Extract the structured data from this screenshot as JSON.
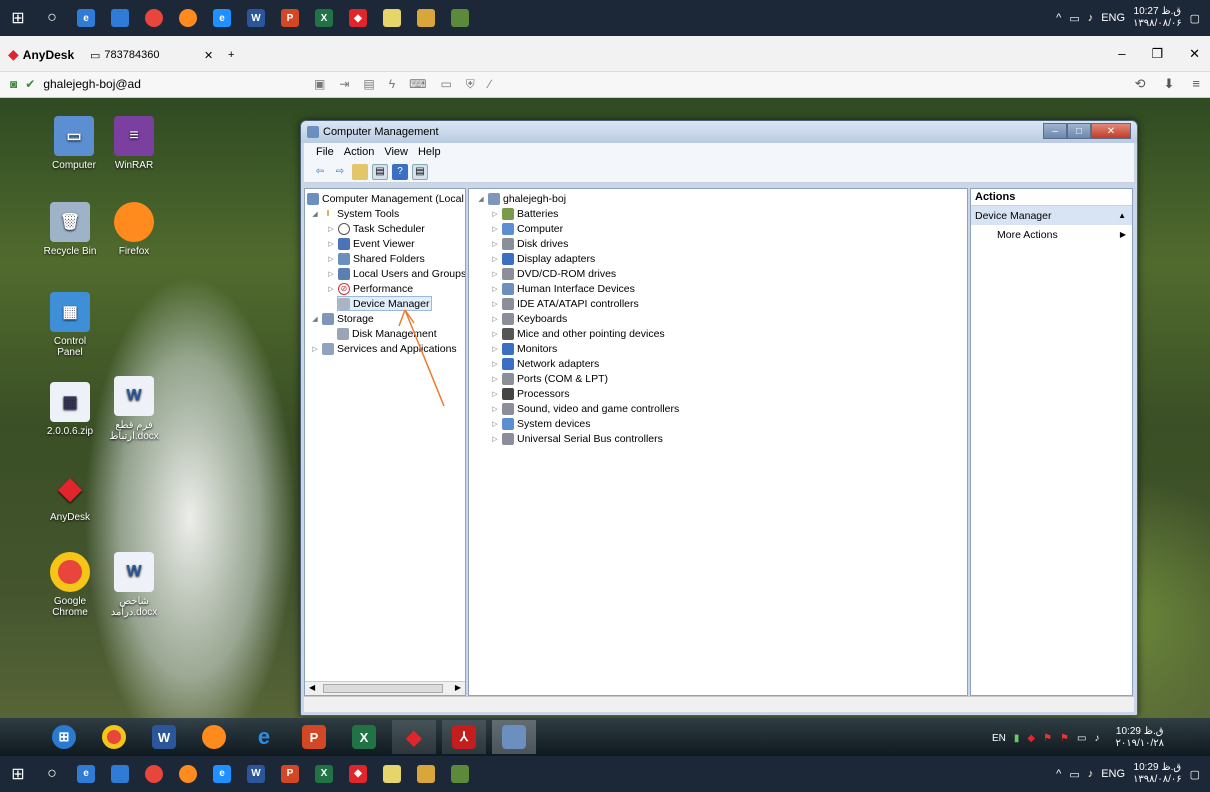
{
  "host_taskbar": {
    "tray": {
      "lang": "ENG",
      "time_top": "10:27 ق.ظ",
      "date_top": "۱۳۹۸/۰۸/۰۶",
      "time_bottom": "10:29 ق.ظ",
      "date_bottom": "۱۳۹۸/۰۸/۰۶"
    }
  },
  "anydesk": {
    "app_name": "AnyDesk",
    "session_id": "783784360",
    "address": "ghalejegh-boj@ad"
  },
  "desktop_icons": [
    {
      "label": "Computer"
    },
    {
      "label": "WinRAR"
    },
    {
      "label": "Recycle Bin"
    },
    {
      "label": "Firefox"
    },
    {
      "label": "Control Panel"
    },
    {
      "label": "2.0.0.6.zip"
    },
    {
      "label": "فرم قطع ارتباط.docx"
    },
    {
      "label": "AnyDesk"
    },
    {
      "label": "Google Chrome"
    },
    {
      "label": "شاخص درآمد.docx"
    }
  ],
  "window": {
    "title": "Computer Management",
    "menu": [
      "File",
      "Action",
      "View",
      "Help"
    ],
    "tree": {
      "root": "Computer Management (Local",
      "system_tools": "System Tools",
      "task_scheduler": "Task Scheduler",
      "event_viewer": "Event Viewer",
      "shared_folders": "Shared Folders",
      "local_users": "Local Users and Groups",
      "performance": "Performance",
      "device_manager": "Device Manager",
      "storage": "Storage",
      "disk_management": "Disk Management",
      "services": "Services and Applications"
    },
    "devices": {
      "host": "ghalejegh-boj",
      "items": [
        "Batteries",
        "Computer",
        "Disk drives",
        "Display adapters",
        "DVD/CD-ROM drives",
        "Human Interface Devices",
        "IDE ATA/ATAPI controllers",
        "Keyboards",
        "Mice and other pointing devices",
        "Monitors",
        "Network adapters",
        "Ports (COM & LPT)",
        "Processors",
        "Sound, video and game controllers",
        "System devices",
        "Universal Serial Bus controllers"
      ]
    },
    "actions": {
      "header": "Actions",
      "selected": "Device Manager",
      "more": "More Actions"
    }
  },
  "remote_taskbar": {
    "lang": "EN",
    "time": "10:29 ق.ظ",
    "date": "۲۰۱۹/۱۰/۲۸"
  }
}
